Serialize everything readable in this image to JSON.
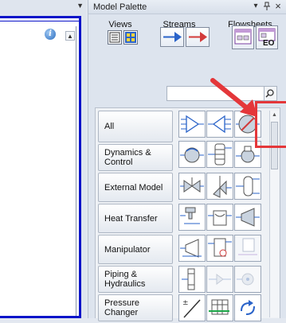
{
  "left_pane": {
    "dropdown_glyph": "▼"
  },
  "palette": {
    "title": "Model Palette",
    "header_dropdown": "▾",
    "header_pin": "ᵖ",
    "header_close": "×",
    "sections": {
      "views": "Views",
      "streams": "Streams",
      "flowsheets": "Flowsheets"
    },
    "eo_label": "EO",
    "search": {
      "value": "",
      "placeholder": ""
    },
    "categories": [
      {
        "id": "all",
        "label": "All"
      },
      {
        "id": "dynamics-control",
        "label": "Dynamics & Control"
      },
      {
        "id": "external-model",
        "label": "External Model"
      },
      {
        "id": "heat-transfer",
        "label": "Heat Transfer"
      },
      {
        "id": "manipulator",
        "label": "Manipulator"
      },
      {
        "id": "piping-hydraulics",
        "label": "Piping & Hydraulics"
      },
      {
        "id": "pressure-changer",
        "label": "Pressure Changer"
      }
    ],
    "icons": [
      [
        "mixer-icon",
        "splitter-icon",
        "heater-icon"
      ],
      [
        "pump-icon",
        "column-icon",
        "compressor-icon"
      ],
      [
        "valve-icon",
        "relief-valve-icon",
        "separator-icon"
      ],
      [
        "cooler-icon",
        "heat-exchanger-icon",
        "expander-icon"
      ],
      [
        "tee-icon",
        "reactor-icon",
        "set-icon"
      ],
      [
        "pipe-icon",
        "pipe-segment-icon",
        "pipe-fitting-icon"
      ],
      [
        "pressure-changer-icon",
        "spreadsheet-icon",
        "recycle-icon"
      ]
    ],
    "colors": {
      "selection_box": "#e4373a",
      "arrow": "#e4373a",
      "left_border": "#0b14c9",
      "stream_blue": "#2a63c9",
      "stream_red": "#d23a3a"
    }
  }
}
